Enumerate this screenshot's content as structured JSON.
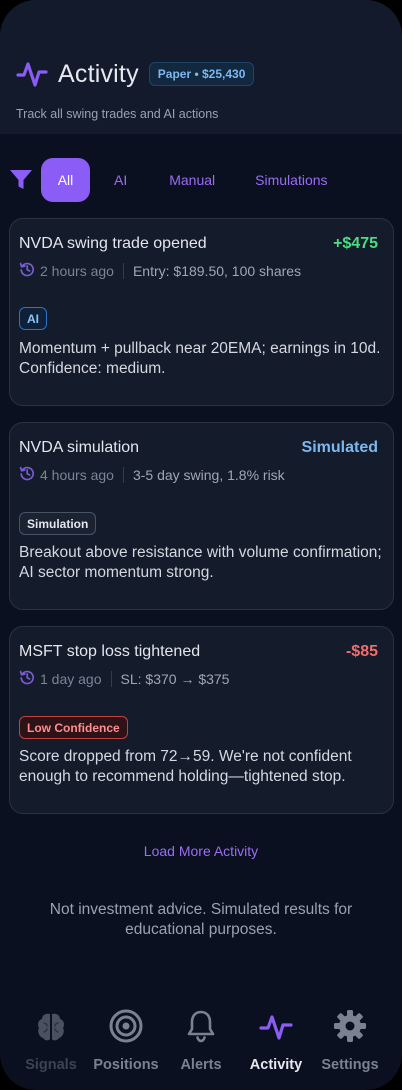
{
  "header": {
    "title": "Activity",
    "badge": "Paper • $25,430",
    "subtitle": "Track all swing trades and AI actions"
  },
  "filters": {
    "icon": "filter-icon",
    "chips": [
      "All",
      "AI",
      "Manual",
      "Simulations"
    ],
    "selected": "All"
  },
  "activities": [
    {
      "title": "NVDA swing trade opened",
      "value": "+$475",
      "value_color": "#4ade80",
      "time": "2 hours ago",
      "detail": "Entry: $189.50, 100 shares",
      "tag": "AI",
      "body": "Momentum + pullback near 20EMA; earnings in 10d. Confidence: medium."
    },
    {
      "title": "NVDA simulation",
      "value": "Simulated",
      "value_color": "#7cb8f0",
      "time": "4 hours ago",
      "detail": "3-5 day swing, 1.8% risk",
      "tag": "Simulation",
      "body": "Breakout above resistance with volume confirmation; AI sector momentum strong."
    },
    {
      "title": "MSFT stop loss tightened",
      "value": "-$85",
      "value_color": "#f26d6d",
      "time": "1 day ago",
      "detail": "SL: $370 → $375",
      "tag": "Low Confidence",
      "body": "Score dropped from 72→59. We're not confident enough to recommend holding—tightened stop."
    }
  ],
  "load_more": "Load More Activity",
  "disclaimer": "Not investment advice. Simulated results for educational purposes.",
  "tabbar": {
    "tabs": [
      {
        "label": "Signals",
        "icon": "brain-icon",
        "state": "disabled"
      },
      {
        "label": "Positions",
        "icon": "target-icon",
        "state": "normal"
      },
      {
        "label": "Alerts",
        "icon": "bell-icon",
        "state": "normal"
      },
      {
        "label": "Activity",
        "icon": "activity-pulse-icon",
        "state": "active"
      },
      {
        "label": "Settings",
        "icon": "gear-icon",
        "state": "normal"
      }
    ]
  },
  "colors": {
    "accent": "#8b5cf6",
    "background": "#0b1020",
    "card": "#141b2b",
    "positive": "#4ade80",
    "negative": "#f26d6d",
    "info": "#7cb8f0"
  }
}
